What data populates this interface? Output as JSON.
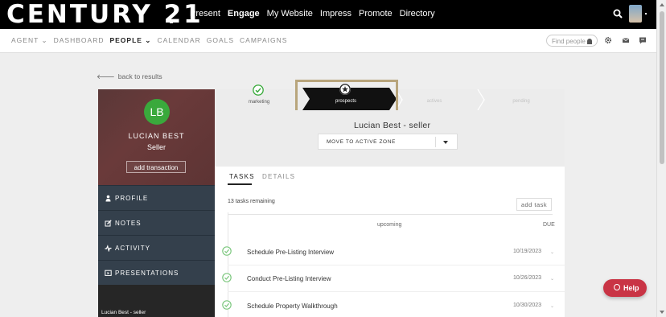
{
  "topbar": {
    "logo": "CENTURY 21",
    "nav": [
      {
        "label": "Present",
        "active": false
      },
      {
        "label": "Engage",
        "active": true
      },
      {
        "label": "My Website",
        "active": false
      },
      {
        "label": "Impress",
        "active": false
      },
      {
        "label": "Promote",
        "active": false
      },
      {
        "label": "Directory",
        "active": false
      }
    ]
  },
  "secnav": {
    "items": [
      {
        "label": "AGENT ⌄",
        "active": false
      },
      {
        "label": "DASHBOARD",
        "active": false
      },
      {
        "label": "PEOPLE ⌄",
        "active": true
      },
      {
        "label": "CALENDAR",
        "active": false
      },
      {
        "label": "GOALS",
        "active": false
      },
      {
        "label": "CAMPAIGNS",
        "active": false
      }
    ],
    "find_people_placeholder": "Find people"
  },
  "back_link": "back to results",
  "profile": {
    "initials": "LB",
    "name": "LUCIAN BEST",
    "role": "Seller",
    "add_transaction": "add transaction"
  },
  "sidebar": {
    "items": [
      {
        "label": "PROFILE",
        "icon": "person-icon"
      },
      {
        "label": "NOTES",
        "icon": "edit-icon"
      },
      {
        "label": "ACTIVITY",
        "icon": "activity-icon"
      },
      {
        "label": "PRESENTATIONS",
        "icon": "presentation-icon"
      }
    ],
    "footer_label": "Lucian Best - seller"
  },
  "pipeline": {
    "steps": [
      "marketing",
      "prospects",
      "actives",
      "pending"
    ]
  },
  "contact": {
    "title": "Lucian Best - seller",
    "zone_select": "MOVE TO ACTIVE ZONE"
  },
  "tabs": [
    "TASKS",
    "DETAILS"
  ],
  "tasks": {
    "remaining": "13 tasks remaining",
    "add_task": "add task",
    "group_label": "upcoming",
    "due_header": "DUE",
    "rows": [
      {
        "name": "Schedule Pre-Listing Interview",
        "due": "10/19/2023"
      },
      {
        "name": "Conduct Pre-Listing Interview",
        "due": "10/26/2023"
      },
      {
        "name": "Schedule Property Walkthrough",
        "due": "10/30/2023"
      }
    ]
  },
  "help_button": "Help",
  "colors": {
    "brand_black": "#000000",
    "accent_green": "#3aa93c",
    "highlight_gold": "#b8a57c",
    "help_red": "#c93445"
  }
}
